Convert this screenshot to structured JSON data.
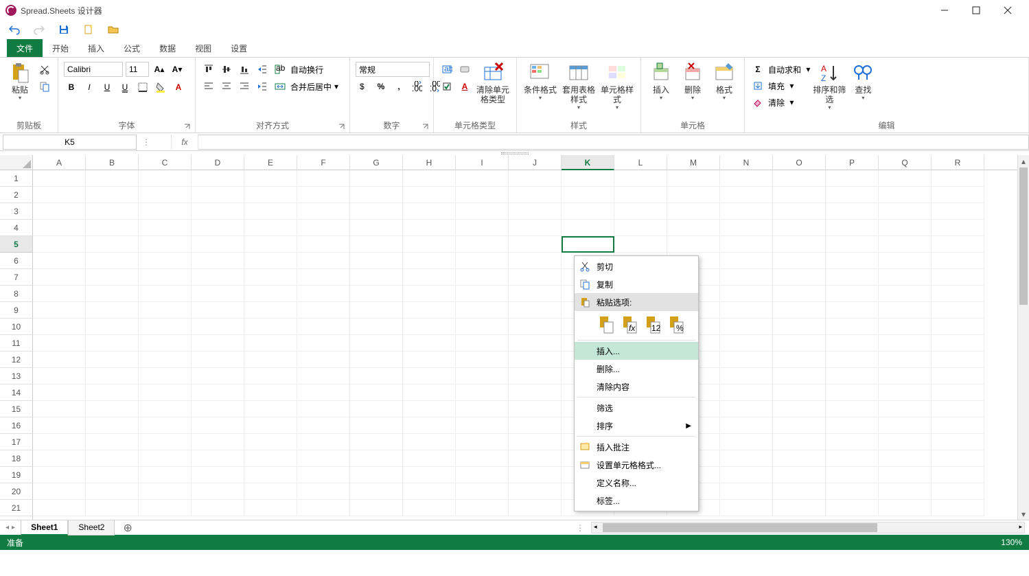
{
  "app": {
    "title": "Spread.Sheets 设计器"
  },
  "tabs": {
    "file": "文件",
    "home": "开始",
    "insert": "插入",
    "formula": "公式",
    "data": "数据",
    "view": "视图",
    "settings": "设置"
  },
  "groups": {
    "clipboard": "剪贴板",
    "font": "字体",
    "alignment": "对齐方式",
    "number": "数字",
    "celltype": "单元格类型",
    "styles": "样式",
    "cells": "单元格",
    "editing": "编辑",
    "paste": "粘贴"
  },
  "font": {
    "name": "Calibri",
    "size": "11"
  },
  "numberFormat": "常规",
  "ribbon": {
    "wrap": "自动换行",
    "merge": "合并后居中",
    "clearCellType": "清除单元格类型",
    "condFmt": "条件格式",
    "tableStyle": "套用表格样式",
    "cellStyle": "单元格样式",
    "insert": "插入",
    "delete": "删除",
    "format": "格式",
    "autosum": "自动求和",
    "fill": "填充",
    "clear": "清除",
    "sort": "排序和筛选",
    "find": "查找"
  },
  "namebox": "K5",
  "columns": [
    "A",
    "B",
    "C",
    "D",
    "E",
    "F",
    "G",
    "H",
    "I",
    "J",
    "K",
    "L",
    "M",
    "N",
    "O",
    "P",
    "Q",
    "R"
  ],
  "rows": [
    "1",
    "2",
    "3",
    "4",
    "5",
    "6",
    "7",
    "8",
    "9",
    "10",
    "11",
    "12",
    "13",
    "14",
    "15",
    "16",
    "17",
    "18",
    "19",
    "20",
    "21"
  ],
  "selectedRow": "5",
  "selectedCol": "K",
  "sheets": [
    "Sheet1",
    "Sheet2"
  ],
  "activeSheet": "Sheet1",
  "status": {
    "ready": "准备",
    "zoom": "130%"
  },
  "ctx": {
    "cut": "剪切",
    "copy": "复制",
    "pasteOptions": "粘贴选项:",
    "insert": "插入...",
    "delete": "删除...",
    "clearContents": "清除内容",
    "filter": "筛选",
    "sort": "排序",
    "insertComment": "插入批注",
    "formatCells": "设置单元格格式...",
    "defineName": "定义名称...",
    "tag": "标签..."
  }
}
